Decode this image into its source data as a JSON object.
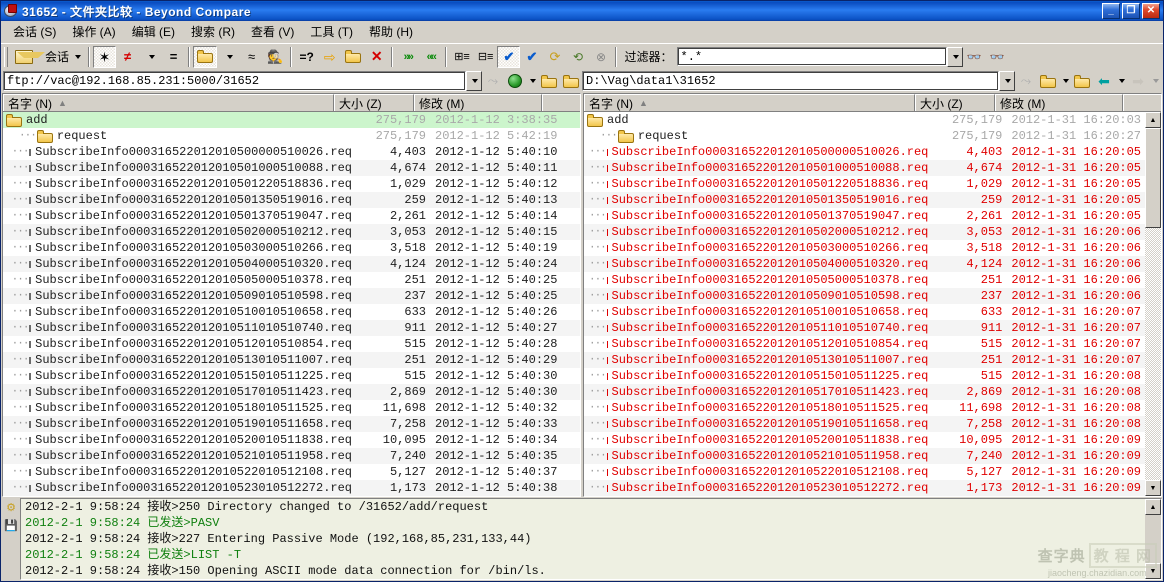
{
  "window": {
    "title": "31652 - 文件夹比较 - Beyond Compare",
    "minimize_label": "_",
    "maximize_label": "❐",
    "close_label": "✕"
  },
  "menu": {
    "items": [
      {
        "label": "会话 (S)"
      },
      {
        "label": "操作 (A)"
      },
      {
        "label": "编辑 (E)"
      },
      {
        "label": "搜索 (R)"
      },
      {
        "label": "查看 (V)"
      },
      {
        "label": "工具 (T)"
      },
      {
        "label": "帮助 (H)"
      }
    ]
  },
  "toolbar": {
    "session_label": "会话",
    "filter_label": "过滤器：",
    "filter_value": "*.*",
    "buttons": [
      {
        "name": "session-button",
        "glyph": "session-icon"
      },
      {
        "name": "show-all-button",
        "glyph": "star"
      },
      {
        "name": "show-differences-button",
        "glyph": "neq"
      },
      {
        "name": "show-same-button",
        "glyph": "eq"
      },
      {
        "name": "show-orphans-button",
        "glyph": "plus-folder"
      },
      {
        "name": "show-similar-button",
        "glyph": "approx"
      },
      {
        "name": "show-hidden-button",
        "glyph": "spy"
      },
      {
        "name": "compare-contents-button",
        "glyph": "eq-question"
      },
      {
        "name": "copy-right-button",
        "glyph": "arrow-right"
      },
      {
        "name": "copy-to-folder-button",
        "glyph": "folder-arrow"
      },
      {
        "name": "delete-button",
        "glyph": "x-mark"
      },
      {
        "name": "next-difference-button",
        "glyph": "chev-right"
      },
      {
        "name": "previous-difference-button",
        "glyph": "chev-left"
      },
      {
        "name": "expand-all-button",
        "glyph": "tree-expand"
      },
      {
        "name": "collapse-all-button",
        "glyph": "tree-collapse"
      },
      {
        "name": "select-all-button",
        "glyph": "check-double"
      },
      {
        "name": "select-none-button",
        "glyph": "check-single"
      },
      {
        "name": "refresh-button",
        "glyph": "refresh"
      },
      {
        "name": "sync-button",
        "glyph": "sync"
      },
      {
        "name": "stop-button",
        "glyph": "stop"
      }
    ]
  },
  "address": {
    "left_path": "ftp://vac@192.168.85.231:5000/31652",
    "right_path": "D:\\Vag\\data1\\31652"
  },
  "columns": {
    "name": "名字 (N)",
    "size": "大小 (Z)",
    "modified": "修改 (M)",
    "sort_arrow": "▲"
  },
  "left_pane": {
    "rows": [
      {
        "type": "folder",
        "indent": 0,
        "name": "add",
        "size": "275,179",
        "modified": "2012-1-12 3:38:35",
        "style": "selected"
      },
      {
        "type": "folder",
        "indent": 1,
        "name": "request",
        "size": "275,179",
        "modified": "2012-1-12 5:42:19",
        "style": "plain"
      },
      {
        "type": "file",
        "indent": 2,
        "name": "SubscribeInfo000316522012010500000510026.req",
        "size": "4,403",
        "modified": "2012-1-12 5:40:10"
      },
      {
        "type": "file",
        "indent": 2,
        "name": "SubscribeInfo000316522012010501000510088.req",
        "size": "4,674",
        "modified": "2012-1-12 5:40:11"
      },
      {
        "type": "file",
        "indent": 2,
        "name": "SubscribeInfo000316522012010501220518836.req",
        "size": "1,029",
        "modified": "2012-1-12 5:40:12"
      },
      {
        "type": "file",
        "indent": 2,
        "name": "SubscribeInfo000316522012010501350519016.req",
        "size": "259",
        "modified": "2012-1-12 5:40:13"
      },
      {
        "type": "file",
        "indent": 2,
        "name": "SubscribeInfo000316522012010501370519047.req",
        "size": "2,261",
        "modified": "2012-1-12 5:40:14"
      },
      {
        "type": "file",
        "indent": 2,
        "name": "SubscribeInfo000316522012010502000510212.req",
        "size": "3,053",
        "modified": "2012-1-12 5:40:15"
      },
      {
        "type": "file",
        "indent": 2,
        "name": "SubscribeInfo000316522012010503000510266.req",
        "size": "3,518",
        "modified": "2012-1-12 5:40:19"
      },
      {
        "type": "file",
        "indent": 2,
        "name": "SubscribeInfo000316522012010504000510320.req",
        "size": "4,124",
        "modified": "2012-1-12 5:40:24"
      },
      {
        "type": "file",
        "indent": 2,
        "name": "SubscribeInfo000316522012010505000510378.req",
        "size": "251",
        "modified": "2012-1-12 5:40:25"
      },
      {
        "type": "file",
        "indent": 2,
        "name": "SubscribeInfo000316522012010509010510598.req",
        "size": "237",
        "modified": "2012-1-12 5:40:25"
      },
      {
        "type": "file",
        "indent": 2,
        "name": "SubscribeInfo000316522012010510010510658.req",
        "size": "633",
        "modified": "2012-1-12 5:40:26"
      },
      {
        "type": "file",
        "indent": 2,
        "name": "SubscribeInfo000316522012010511010510740.req",
        "size": "911",
        "modified": "2012-1-12 5:40:27"
      },
      {
        "type": "file",
        "indent": 2,
        "name": "SubscribeInfo000316522012010512010510854.req",
        "size": "515",
        "modified": "2012-1-12 5:40:28"
      },
      {
        "type": "file",
        "indent": 2,
        "name": "SubscribeInfo000316522012010513010511007.req",
        "size": "251",
        "modified": "2012-1-12 5:40:29"
      },
      {
        "type": "file",
        "indent": 2,
        "name": "SubscribeInfo000316522012010515010511225.req",
        "size": "515",
        "modified": "2012-1-12 5:40:30"
      },
      {
        "type": "file",
        "indent": 2,
        "name": "SubscribeInfo000316522012010517010511423.req",
        "size": "2,869",
        "modified": "2012-1-12 5:40:30"
      },
      {
        "type": "file",
        "indent": 2,
        "name": "SubscribeInfo000316522012010518010511525.req",
        "size": "11,698",
        "modified": "2012-1-12 5:40:32"
      },
      {
        "type": "file",
        "indent": 2,
        "name": "SubscribeInfo000316522012010519010511658.req",
        "size": "7,258",
        "modified": "2012-1-12 5:40:33"
      },
      {
        "type": "file",
        "indent": 2,
        "name": "SubscribeInfo000316522012010520010511838.req",
        "size": "10,095",
        "modified": "2012-1-12 5:40:34"
      },
      {
        "type": "file",
        "indent": 2,
        "name": "SubscribeInfo000316522012010521010511958.req",
        "size": "7,240",
        "modified": "2012-1-12 5:40:35"
      },
      {
        "type": "file",
        "indent": 2,
        "name": "SubscribeInfo000316522012010522010512108.req",
        "size": "5,127",
        "modified": "2012-1-12 5:40:37"
      },
      {
        "type": "file",
        "indent": 2,
        "name": "SubscribeInfo000316522012010523010512272.req",
        "size": "1,173",
        "modified": "2012-1-12 5:40:38"
      }
    ]
  },
  "right_pane": {
    "rows": [
      {
        "type": "folder",
        "indent": 0,
        "name": "add",
        "size": "275,179",
        "modified": "2012-1-31 16:20:03",
        "style": "plain"
      },
      {
        "type": "folder",
        "indent": 1,
        "name": "request",
        "size": "275,179",
        "modified": "2012-1-31 16:20:27",
        "style": "plain"
      },
      {
        "type": "file",
        "indent": 2,
        "name": "SubscribeInfo000316522012010500000510026.req",
        "size": "4,403",
        "modified": "2012-1-31 16:20:05"
      },
      {
        "type": "file",
        "indent": 2,
        "name": "SubscribeInfo000316522012010501000510088.req",
        "size": "4,674",
        "modified": "2012-1-31 16:20:05"
      },
      {
        "type": "file",
        "indent": 2,
        "name": "SubscribeInfo000316522012010501220518836.req",
        "size": "1,029",
        "modified": "2012-1-31 16:20:05"
      },
      {
        "type": "file",
        "indent": 2,
        "name": "SubscribeInfo000316522012010501350519016.req",
        "size": "259",
        "modified": "2012-1-31 16:20:05"
      },
      {
        "type": "file",
        "indent": 2,
        "name": "SubscribeInfo000316522012010501370519047.req",
        "size": "2,261",
        "modified": "2012-1-31 16:20:05"
      },
      {
        "type": "file",
        "indent": 2,
        "name": "SubscribeInfo000316522012010502000510212.req",
        "size": "3,053",
        "modified": "2012-1-31 16:20:06"
      },
      {
        "type": "file",
        "indent": 2,
        "name": "SubscribeInfo000316522012010503000510266.req",
        "size": "3,518",
        "modified": "2012-1-31 16:20:06"
      },
      {
        "type": "file",
        "indent": 2,
        "name": "SubscribeInfo000316522012010504000510320.req",
        "size": "4,124",
        "modified": "2012-1-31 16:20:06"
      },
      {
        "type": "file",
        "indent": 2,
        "name": "SubscribeInfo000316522012010505000510378.req",
        "size": "251",
        "modified": "2012-1-31 16:20:06"
      },
      {
        "type": "file",
        "indent": 2,
        "name": "SubscribeInfo000316522012010509010510598.req",
        "size": "237",
        "modified": "2012-1-31 16:20:06"
      },
      {
        "type": "file",
        "indent": 2,
        "name": "SubscribeInfo000316522012010510010510658.req",
        "size": "633",
        "modified": "2012-1-31 16:20:07"
      },
      {
        "type": "file",
        "indent": 2,
        "name": "SubscribeInfo000316522012010511010510740.req",
        "size": "911",
        "modified": "2012-1-31 16:20:07"
      },
      {
        "type": "file",
        "indent": 2,
        "name": "SubscribeInfo000316522012010512010510854.req",
        "size": "515",
        "modified": "2012-1-31 16:20:07"
      },
      {
        "type": "file",
        "indent": 2,
        "name": "SubscribeInfo000316522012010513010511007.req",
        "size": "251",
        "modified": "2012-1-31 16:20:07"
      },
      {
        "type": "file",
        "indent": 2,
        "name": "SubscribeInfo000316522012010515010511225.req",
        "size": "515",
        "modified": "2012-1-31 16:20:08"
      },
      {
        "type": "file",
        "indent": 2,
        "name": "SubscribeInfo000316522012010517010511423.req",
        "size": "2,869",
        "modified": "2012-1-31 16:20:08"
      },
      {
        "type": "file",
        "indent": 2,
        "name": "SubscribeInfo000316522012010518010511525.req",
        "size": "11,698",
        "modified": "2012-1-31 16:20:08"
      },
      {
        "type": "file",
        "indent": 2,
        "name": "SubscribeInfo000316522012010519010511658.req",
        "size": "7,258",
        "modified": "2012-1-31 16:20:08"
      },
      {
        "type": "file",
        "indent": 2,
        "name": "SubscribeInfo000316522012010520010511838.req",
        "size": "10,095",
        "modified": "2012-1-31 16:20:09"
      },
      {
        "type": "file",
        "indent": 2,
        "name": "SubscribeInfo000316522012010521010511958.req",
        "size": "7,240",
        "modified": "2012-1-31 16:20:09"
      },
      {
        "type": "file",
        "indent": 2,
        "name": "SubscribeInfo000316522012010522010512108.req",
        "size": "5,127",
        "modified": "2012-1-31 16:20:09"
      },
      {
        "type": "file",
        "indent": 2,
        "name": "SubscribeInfo000316522012010523010512272.req",
        "size": "1,173",
        "modified": "2012-1-31 16:20:09"
      }
    ]
  },
  "log": {
    "lines": [
      {
        "time": "2012-2-1  9:58:24",
        "dir": "接收>",
        "text": "250 Directory changed to /31652/add/request",
        "kind": "recv"
      },
      {
        "time": "2012-2-1  9:58:24",
        "dir": "已发送>",
        "text": "PASV",
        "kind": "sent"
      },
      {
        "time": "2012-2-1  9:58:24",
        "dir": "接收>",
        "text": "227 Entering Passive Mode (192,168,85,231,133,44)",
        "kind": "recv"
      },
      {
        "time": "2012-2-1  9:58:24",
        "dir": "已发送>",
        "text": "LIST -T",
        "kind": "sent"
      },
      {
        "time": "2012-2-1  9:58:24",
        "dir": "接收>",
        "text": "150 Opening ASCII mode data connection for /bin/ls.",
        "kind": "recv"
      }
    ]
  },
  "watermark": {
    "line1": "查字典",
    "line1b": "教 程 网",
    "line2": "jiaocheng.chazidian.com"
  },
  "colors": {
    "title_blue": "#0a4cc0",
    "diff_red": "#e00000",
    "folder_green": "#ccf5cc",
    "sent_green": "#108010",
    "face": "#d4d0c8",
    "log_bg": "#eef0e2"
  }
}
